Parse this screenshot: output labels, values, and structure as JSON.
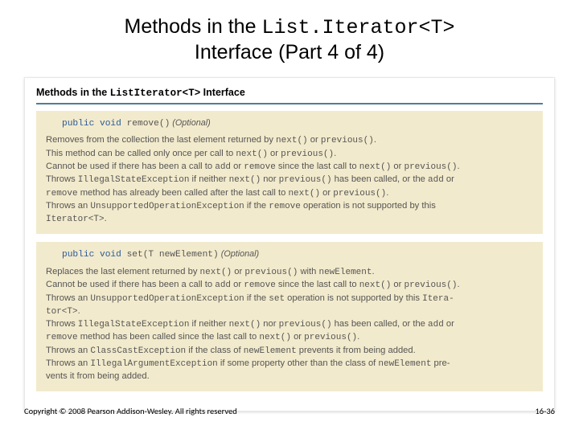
{
  "title": {
    "prefix": "Methods in the ",
    "code": "List.Iterator<T>",
    "line2": "Interface (Part 4 of 4)"
  },
  "panel": {
    "heading_prefix": "Methods in the ",
    "heading_code": "ListIterator<T>",
    "heading_suffix": " Interface"
  },
  "method1": {
    "sig_kw": "public void",
    "sig_name": " remove()",
    "sig_opt": " (Optional)",
    "lines": [
      {
        "t": "Removes from the collection the last element returned by ",
        "c1": "next()",
        "t2": " or ",
        "c2": "previous()",
        "t3": "."
      },
      {
        "t": "This method can be called only once per call to ",
        "c1": "next()",
        "t2": " or ",
        "c2": "previous()",
        "t3": "."
      },
      {
        "t": "Cannot be used if there has been a call to ",
        "c1": "add",
        "t2": " or ",
        "c2": "remove",
        "t3": " since the last call to ",
        "c3": "next()",
        "t4": " or ",
        "c4": "previous()",
        "t5": "."
      },
      {
        "t": "Throws ",
        "c1": "IllegalStateException",
        "t2": " if neither ",
        "c2": "next()",
        "t3": " nor ",
        "c3": "previous()",
        "t4": " has been called, or the ",
        "c4": "add",
        "t5": " or"
      },
      {
        "c1": "remove",
        "t2": " method has already been called after the last call to ",
        "c2": "next()",
        "t3": " or ",
        "c3": "previous()",
        "t4": "."
      },
      {
        "t": "Throws an ",
        "c1": "UnsupportedOperationException",
        "t2": " if the ",
        "c2": "remove",
        "t3": " operation is not supported by this"
      },
      {
        "c1": "Iterator<T>",
        "t2": "."
      }
    ]
  },
  "method2": {
    "sig_kw": "public void",
    "sig_name": " set(T newElement)",
    "sig_opt": " (Optional)",
    "lines": [
      {
        "t": "Replaces the last element returned by ",
        "c1": "next()",
        "t2": " or ",
        "c2": "previous()",
        "t3": " with ",
        "c3": "newElement",
        "t4": "."
      },
      {
        "t": "Cannot be used if there has been a call to ",
        "c1": "add",
        "t2": " or ",
        "c2": "remove",
        "t3": " since the last call to ",
        "c3": "next()",
        "t4": " or ",
        "c4": "previous()",
        "t5": "."
      },
      {
        "t": "Throws an ",
        "c1": "UnsupportedOperationException",
        "t2": " if the ",
        "c2": "set",
        "t3": " operation is not supported by this ",
        "c3": "Itera-"
      },
      {
        "c1": "tor<T>",
        "t2": "."
      },
      {
        "t": "Throws ",
        "c1": "IllegalStateException",
        "t2": " if neither ",
        "c2": "next()",
        "t3": " nor ",
        "c3": "previous()",
        "t4": " has been called, or the ",
        "c4": "add",
        "t5": " or"
      },
      {
        "c1": "remove",
        "t2": " method has been called since the last call to ",
        "c2": "next()",
        "t3": " or ",
        "c3": "previous()",
        "t4": "."
      },
      {
        "t": "Throws an ",
        "c1": "ClassCastException",
        "t2": " if the class of ",
        "c2": "newElement",
        "t3": " prevents it from being added."
      },
      {
        "t": "Throws an ",
        "c1": "IllegalArgumentException",
        "t2": " if some property other than the class of ",
        "c2": "newElement",
        "t3": " pre-"
      },
      {
        "t": "vents it from being added."
      }
    ]
  },
  "footer": {
    "left": "Copyright © 2008 Pearson Addison-Wesley. All rights reserved",
    "right": "16-36"
  }
}
